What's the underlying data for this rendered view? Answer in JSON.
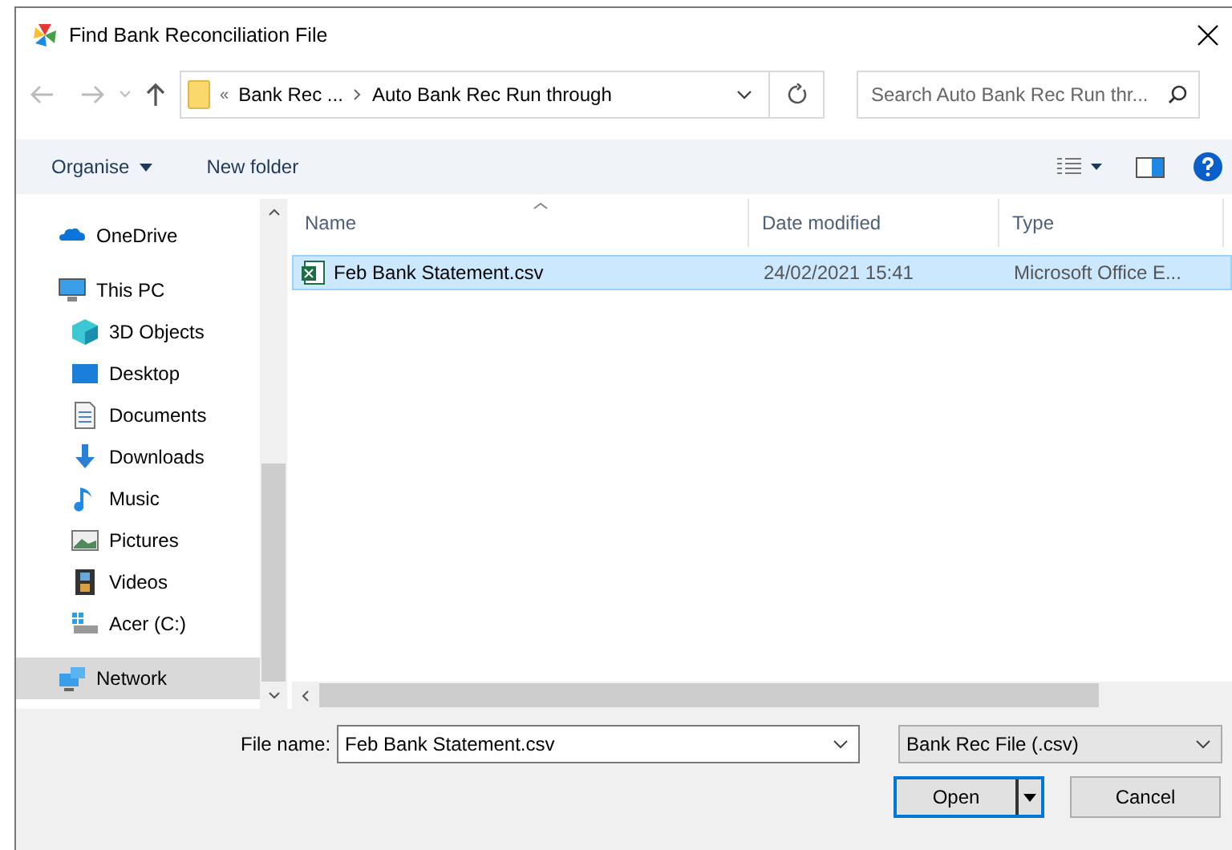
{
  "window": {
    "title": "Find Bank Reconciliation File"
  },
  "address": {
    "breadcrumbs": [
      "«",
      "Bank Rec ...",
      "Auto Bank Rec Run through"
    ]
  },
  "search": {
    "placeholder": "Search Auto Bank Rec Run thr..."
  },
  "toolbar": {
    "organise": "Organise",
    "new_folder": "New folder"
  },
  "sidebar": {
    "items": [
      {
        "label": "OneDrive",
        "kind": "cloud",
        "selected": false
      },
      {
        "label": "This PC",
        "kind": "pc",
        "selected": false,
        "children": [
          {
            "label": "3D Objects",
            "kind": "cube",
            "selected": false
          },
          {
            "label": "Desktop",
            "kind": "desktop",
            "selected": false
          },
          {
            "label": "Documents",
            "kind": "document",
            "selected": false
          },
          {
            "label": "Downloads",
            "kind": "download",
            "selected": false
          },
          {
            "label": "Music",
            "kind": "music",
            "selected": false
          },
          {
            "label": "Pictures",
            "kind": "picture",
            "selected": false
          },
          {
            "label": "Videos",
            "kind": "video",
            "selected": false
          },
          {
            "label": "Acer (C:)",
            "kind": "drive",
            "selected": false
          }
        ]
      },
      {
        "label": "Network",
        "kind": "network",
        "selected": true
      }
    ]
  },
  "table": {
    "columns": [
      "Name",
      "Date modified",
      "Type"
    ],
    "rows": [
      {
        "cells": [
          "Feb Bank Statement.csv",
          "24/02/2021 15:41",
          "Microsoft Office E..."
        ],
        "selected": true
      }
    ]
  },
  "footer": {
    "file_name_label": "File name:",
    "file_name": "Feb Bank Statement.csv",
    "file_type": "Bank Rec File (.csv)",
    "open": "Open",
    "cancel": "Cancel"
  }
}
